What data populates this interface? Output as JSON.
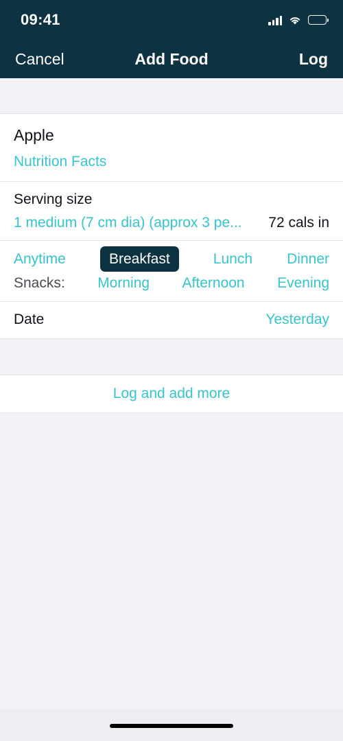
{
  "status_bar": {
    "time": "09:41",
    "signal_icon": "cellular-signal-icon",
    "wifi_icon": "wifi-icon",
    "battery_icon": "battery-icon"
  },
  "nav_bar": {
    "cancel_label": "Cancel",
    "title": "Add Food",
    "log_label": "Log"
  },
  "food": {
    "name": "Apple",
    "nutrition_link": "Nutrition Facts"
  },
  "serving": {
    "label": "Serving size",
    "value": "1 medium (7 cm dia) (approx 3 pe...",
    "calories": "72 cals in"
  },
  "meals": {
    "primary": [
      {
        "label": "Anytime",
        "selected": false
      },
      {
        "label": "Breakfast",
        "selected": true
      },
      {
        "label": "Lunch",
        "selected": false
      },
      {
        "label": "Dinner",
        "selected": false
      }
    ],
    "snacks_label": "Snacks:",
    "snacks": [
      {
        "label": "Morning",
        "selected": false
      },
      {
        "label": "Afternoon",
        "selected": false
      },
      {
        "label": "Evening",
        "selected": false
      }
    ]
  },
  "date": {
    "label": "Date",
    "value": "Yesterday"
  },
  "actions": {
    "log_and_add_more": "Log and add more"
  },
  "colors": {
    "accent_teal": "#38c3cd",
    "header_navy": "#0d3343",
    "page_background": "#f2f1f5",
    "card_background": "#ffffff",
    "text_primary": "#12131a",
    "text_secondary": "#4a4a52"
  }
}
